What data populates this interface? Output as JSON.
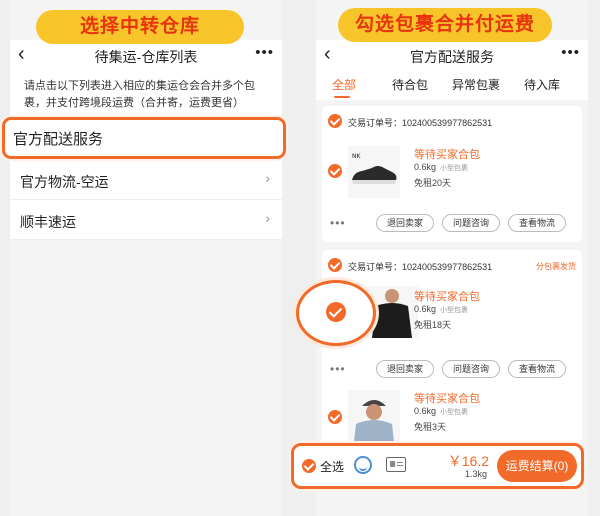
{
  "left": {
    "banner": "选择中转仓库",
    "title": "待集运-仓库列表",
    "notice": "请点击以下列表进入相应的集运仓会合并多个包裹，并支付跨境段运费（合并寄，运费更省）",
    "highlighted_item": "官方配送服务",
    "items": [
      {
        "label": "官方物流-空运"
      },
      {
        "label": "顺丰速运"
      }
    ]
  },
  "right": {
    "banner": "勾选包裹合并付运费",
    "title": "官方配送服务",
    "tabs": [
      "全部",
      "待合包",
      "异常包裹",
      "待入库"
    ],
    "orders": [
      {
        "order_label": "交易订单号：",
        "order_no": "102400539977862531",
        "tag": "",
        "items": [
          {
            "status": "等待买家合包",
            "weight": "0.6kg",
            "size": "小型包裹",
            "free": "免租20天"
          }
        ],
        "buttons": [
          "退回卖家",
          "问题咨询",
          "查看物流"
        ]
      },
      {
        "order_label": "交易订单号：",
        "order_no": "102400539977862531",
        "tag": "分包裹发货",
        "items": [
          {
            "status": "等待买家合包",
            "weight": "0.6kg",
            "size": "小型包裹",
            "free": "免租18天"
          },
          {
            "status": "等待买家合包",
            "weight": "0.6kg",
            "size": "小型包裹",
            "free": "免租3天"
          }
        ],
        "buttons": [
          "退回卖家",
          "问题咨询",
          "查看物流"
        ]
      }
    ],
    "bottom": {
      "select_all": "全选",
      "price": "￥16.2",
      "total_weight": "1.3kg",
      "pay_button": "运费结算(0)"
    }
  },
  "colors": {
    "accent": "#f26a2a",
    "banner_bg": "#f7c52a",
    "banner_text": "#e8340e"
  }
}
